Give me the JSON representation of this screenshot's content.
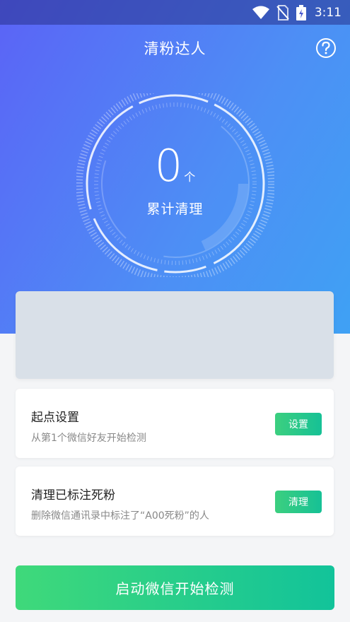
{
  "status": {
    "time": "3:11"
  },
  "header": {
    "title": "清粉达人"
  },
  "counter": {
    "value": "0",
    "unit": "个",
    "label": "累计清理"
  },
  "cards": [
    {
      "title": "起点设置",
      "desc": "从第1个微信好友开始检测",
      "button": "设置"
    },
    {
      "title": "清理已标注死粉",
      "desc": "删除微信通讯录中标注了“A00死粉”的人",
      "button": "清理"
    }
  ],
  "main_button": {
    "label": "启动微信开始检测"
  },
  "colors": {
    "hero_start": "#5b63f6",
    "hero_end": "#3fa1f4",
    "accent_green": "#16c196"
  }
}
